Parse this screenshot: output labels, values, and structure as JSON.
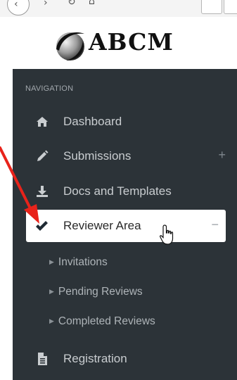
{
  "logo": {
    "text": "ABCM"
  },
  "nav": {
    "heading": "NAVIGATION",
    "items": [
      {
        "label": "Dashboard",
        "icon": "home-icon"
      },
      {
        "label": "Submissions",
        "icon": "pencil-icon",
        "toggle": "+"
      },
      {
        "label": "Docs and Templates",
        "icon": "download-icon"
      },
      {
        "label": "Reviewer Area",
        "icon": "check-icon",
        "toggle": "−"
      },
      {
        "label": "Registration",
        "icon": "document-icon"
      }
    ],
    "reviewer_sub": [
      "Invitations",
      "Pending Reviews",
      "Completed Reviews"
    ]
  },
  "colors": {
    "sidebar": "#2c3338",
    "active": "#ffffff",
    "annotation_arrow": "#e8231b"
  }
}
